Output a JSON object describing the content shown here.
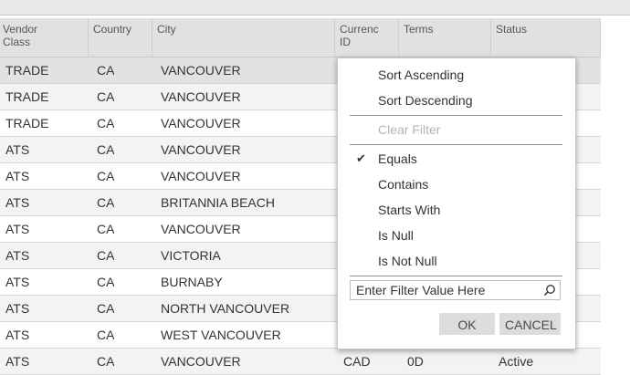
{
  "grid": {
    "columns": [
      {
        "label": "Vendor Class"
      },
      {
        "label": "Country"
      },
      {
        "label": "City"
      },
      {
        "label": "Currenc ID"
      },
      {
        "label": "Terms"
      },
      {
        "label": "Status"
      }
    ],
    "rows": [
      {
        "vendor_class": "TRADE",
        "country": "CA",
        "city": "VANCOUVER",
        "currency": "",
        "terms": "",
        "status": ""
      },
      {
        "vendor_class": "TRADE",
        "country": "CA",
        "city": "VANCOUVER",
        "currency": "",
        "terms": "",
        "status": ""
      },
      {
        "vendor_class": "TRADE",
        "country": "CA",
        "city": "VANCOUVER",
        "currency": "",
        "terms": "",
        "status": ""
      },
      {
        "vendor_class": "ATS",
        "country": "CA",
        "city": "VANCOUVER",
        "currency": "",
        "terms": "",
        "status": ""
      },
      {
        "vendor_class": "ATS",
        "country": "CA",
        "city": "VANCOUVER",
        "currency": "",
        "terms": "",
        "status": ""
      },
      {
        "vendor_class": "ATS",
        "country": "CA",
        "city": "BRITANNIA BEACH",
        "currency": "",
        "terms": "",
        "status": ""
      },
      {
        "vendor_class": "ATS",
        "country": "CA",
        "city": "VANCOUVER",
        "currency": "",
        "terms": "",
        "status": ""
      },
      {
        "vendor_class": "ATS",
        "country": "CA",
        "city": "VICTORIA",
        "currency": "",
        "terms": "",
        "status": ""
      },
      {
        "vendor_class": "ATS",
        "country": "CA",
        "city": "BURNABY",
        "currency": "",
        "terms": "",
        "status": ""
      },
      {
        "vendor_class": "ATS",
        "country": "CA",
        "city": "NORTH VANCOUVER",
        "currency": "",
        "terms": "",
        "status": ""
      },
      {
        "vendor_class": "ATS",
        "country": "CA",
        "city": "WEST VANCOUVER",
        "currency": "",
        "terms": "",
        "status": ""
      },
      {
        "vendor_class": "ATS",
        "country": "CA",
        "city": "VANCOUVER",
        "currency": "CAD",
        "terms": "0D",
        "status": "Active"
      }
    ]
  },
  "filter_menu": {
    "sort_ascending": "Sort Ascending",
    "sort_descending": "Sort Descending",
    "clear_filter": "Clear Filter",
    "conditions": [
      {
        "label": "Equals",
        "checked": true
      },
      {
        "label": "Contains",
        "checked": false
      },
      {
        "label": "Starts With",
        "checked": false
      },
      {
        "label": "Is Null",
        "checked": false
      },
      {
        "label": "Is Not Null",
        "checked": false
      }
    ],
    "check_mark": "✔",
    "filter_input": {
      "value": "",
      "placeholder": "Enter Filter Value Here"
    },
    "ok_label": "OK",
    "cancel_label": "CANCEL",
    "search_icon": "search-icon"
  }
}
